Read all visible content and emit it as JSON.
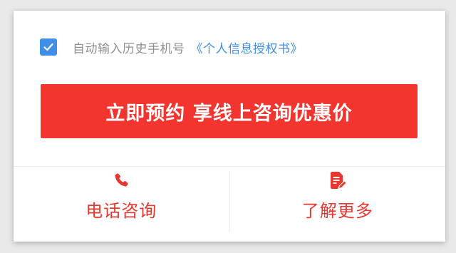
{
  "consent": {
    "checked": true,
    "text": "自动输入历史手机号",
    "link": "《个人信息授权书》"
  },
  "cta": {
    "label": "立即预约 享线上咨询优惠价"
  },
  "footer": {
    "items": [
      {
        "label": "电话咨询",
        "icon": "phone-icon"
      },
      {
        "label": "了解更多",
        "icon": "document-edit-icon"
      }
    ]
  },
  "colors": {
    "accent_blue": "#3f8ee8",
    "primary_red": "#f2362f",
    "label_red": "#e8372f",
    "muted_text": "#8f8f8f"
  }
}
